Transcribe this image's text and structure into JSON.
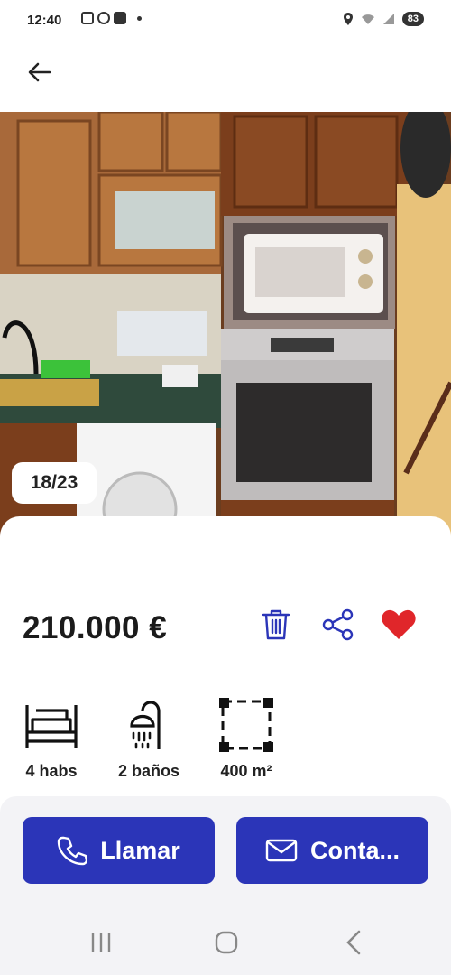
{
  "status_bar": {
    "time": "12:40",
    "battery": "83"
  },
  "header": {
    "back_icon": "arrow-left-icon"
  },
  "gallery": {
    "counter": "18/23"
  },
  "listing": {
    "price": "210.000 €",
    "actions": {
      "delete_icon": "trash-icon",
      "share_icon": "share-icon",
      "favorite_icon": "heart-icon",
      "favorite_active": true
    },
    "features": [
      {
        "icon": "bed-icon",
        "label": "4 habs"
      },
      {
        "icon": "shower-icon",
        "label": "2 baños"
      },
      {
        "icon": "area-icon",
        "label": "400 m²"
      }
    ]
  },
  "cta": {
    "call_label": "Llamar",
    "contact_label": "Conta..."
  },
  "colors": {
    "primary": "#2b35b8",
    "favorite": "#e0262a",
    "icon_blue": "#2b35b8"
  }
}
